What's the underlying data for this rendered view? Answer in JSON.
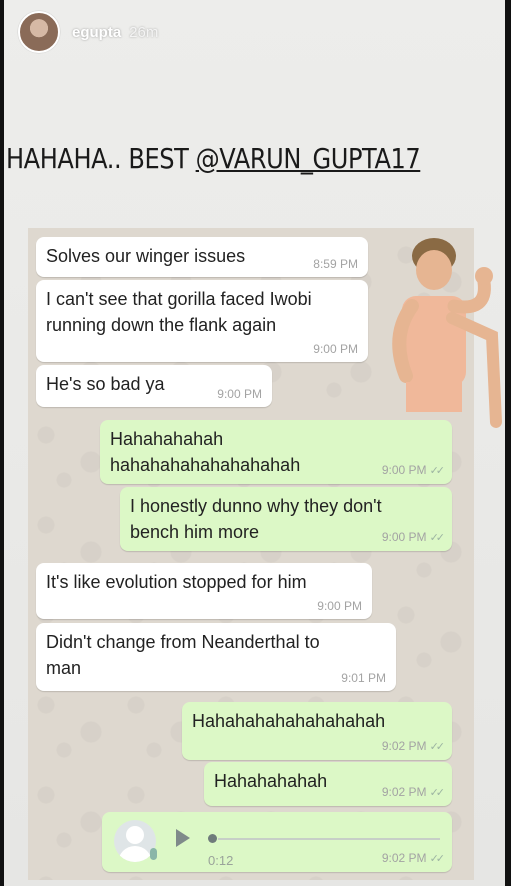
{
  "story": {
    "username": "egupta",
    "time_ago": "26m",
    "caption_text": "HAHAHA.. BEST ",
    "caption_mention": "@VARUN_GUPTA17"
  },
  "messages": [
    {
      "text": "Solves our winger issues",
      "time": "8:59 PM"
    },
    {
      "text": "I can't see that gorilla faced Iwobi\nrunning down the flank again",
      "time": "9:00 PM"
    },
    {
      "text": "He's so bad ya",
      "time": "9:00 PM"
    },
    {
      "text": "Hahahahahah\nhahahahahahahahahah",
      "time": "9:00 PM"
    },
    {
      "text": "I honestly dunno why they don't\nbench him more",
      "time": "9:00 PM"
    },
    {
      "text": "It's like evolution stopped for him",
      "time": "9:00 PM"
    },
    {
      "text": "Didn't change from Neanderthal to\nman",
      "time": "9:01 PM"
    },
    {
      "text": "Hahahahahahahahahah",
      "time": "9:02 PM"
    },
    {
      "text": "Hahahahahah",
      "time": "9:02 PM"
    }
  ],
  "voice_note": {
    "duration": "0:12",
    "time": "9:02 PM"
  },
  "icons": {
    "read_ticks": "double-check-icon",
    "play": "play-icon",
    "mic": "mic-icon"
  },
  "colors": {
    "incoming_bubble": "#ffffff",
    "outgoing_bubble": "#dcf8c6",
    "chat_background": "#ded8cf"
  }
}
